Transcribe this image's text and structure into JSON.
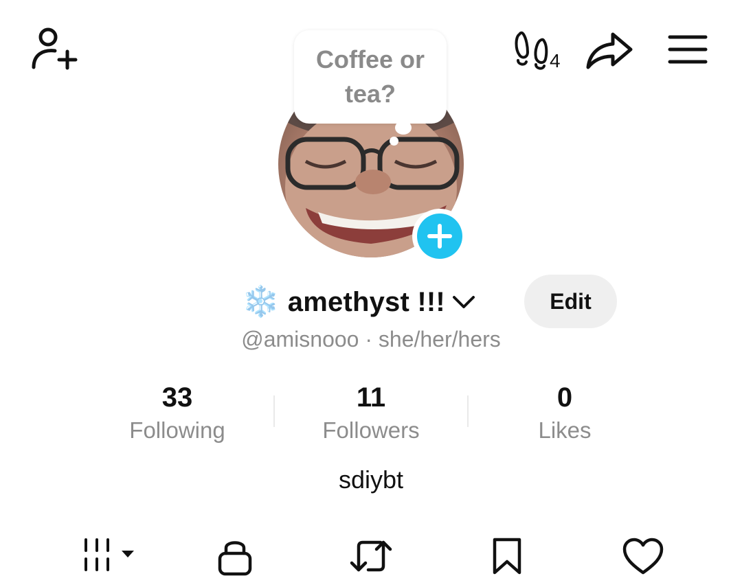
{
  "header": {
    "add_friend_icon": "person-add-icon",
    "footprints_icon": "footprints-icon",
    "footprints_count": "4",
    "share_icon": "share-arrow-icon",
    "menu_icon": "hamburger-menu-icon"
  },
  "bubble": {
    "text": "Coffee or tea?"
  },
  "profile": {
    "emoji": "❄️",
    "display_name": "amethyst !!!",
    "edit_label": "Edit",
    "handle_line": "@amisnooo · she/her/hers",
    "bio": "sdiybt"
  },
  "stats": {
    "following": {
      "value": "33",
      "label": "Following"
    },
    "followers": {
      "value": "11",
      "label": "Followers"
    },
    "likes": {
      "value": "0",
      "label": "Likes"
    }
  },
  "tabs": [
    {
      "name": "videos",
      "icon": "grid-bars-icon"
    },
    {
      "name": "private",
      "icon": "lock-icon"
    },
    {
      "name": "reposts",
      "icon": "repost-icon"
    },
    {
      "name": "favorites",
      "icon": "bookmark-icon"
    },
    {
      "name": "liked",
      "icon": "heart-icon"
    }
  ],
  "colors": {
    "accent": "#20c3f0",
    "muted_text": "#8c8c8c",
    "edit_button_bg": "#efefef"
  }
}
